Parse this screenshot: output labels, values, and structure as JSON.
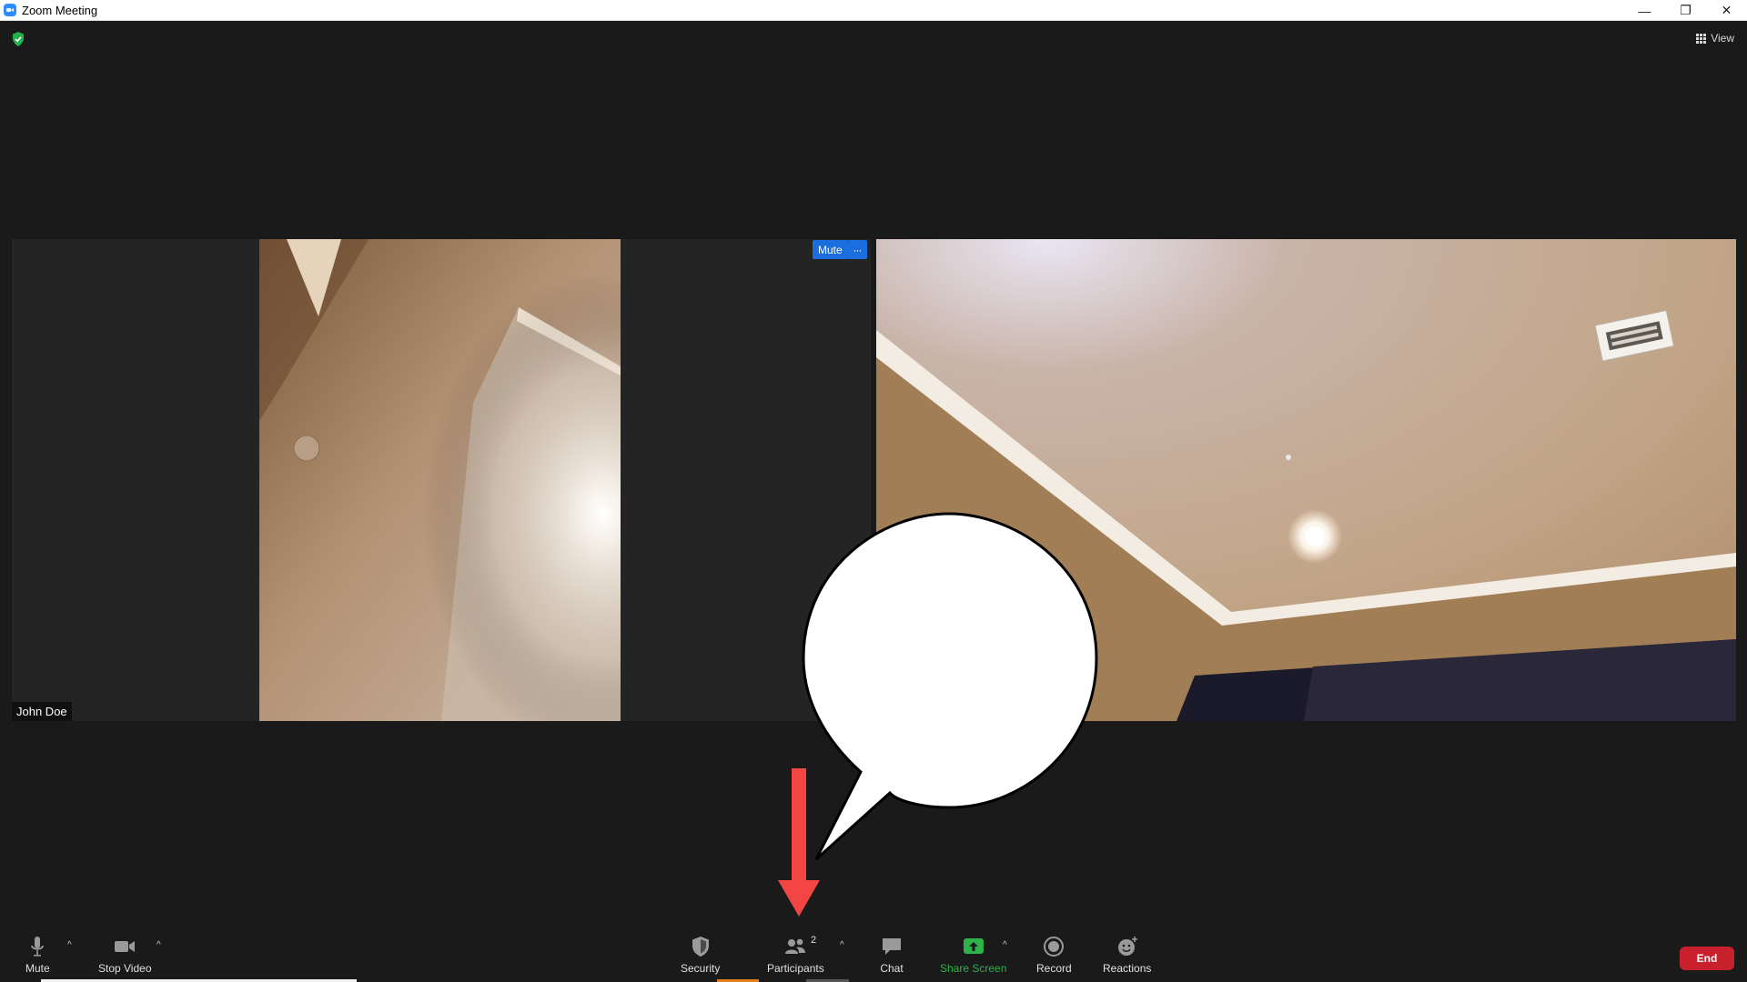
{
  "window": {
    "title": "Zoom Meeting",
    "minimize": "—",
    "restore": "❐",
    "close": "✕"
  },
  "view": {
    "label": "View"
  },
  "tiles": {
    "left": {
      "name": "John Doe"
    },
    "right": {
      "mute_label": "Mute",
      "more_label": "···"
    }
  },
  "toolbar": {
    "mute": "Mute",
    "stop_video": "Stop Video",
    "security": "Security",
    "participants": "Participants",
    "participants_count": "2",
    "chat": "Chat",
    "share_screen": "Share Screen",
    "record": "Record",
    "reactions": "Reactions",
    "end": "End",
    "caret": "^"
  },
  "colors": {
    "accent_blue": "#2d8cff",
    "share_green": "#2db34a",
    "end_red": "#c8202d",
    "arrow_red": "#f44545"
  },
  "icons": [
    "zoom-app-icon",
    "shield-check-icon",
    "grid-icon",
    "microphone-icon",
    "video-camera-icon",
    "security-shield-icon",
    "participants-icon",
    "chat-icon",
    "share-screen-icon",
    "record-icon",
    "reactions-icon"
  ]
}
